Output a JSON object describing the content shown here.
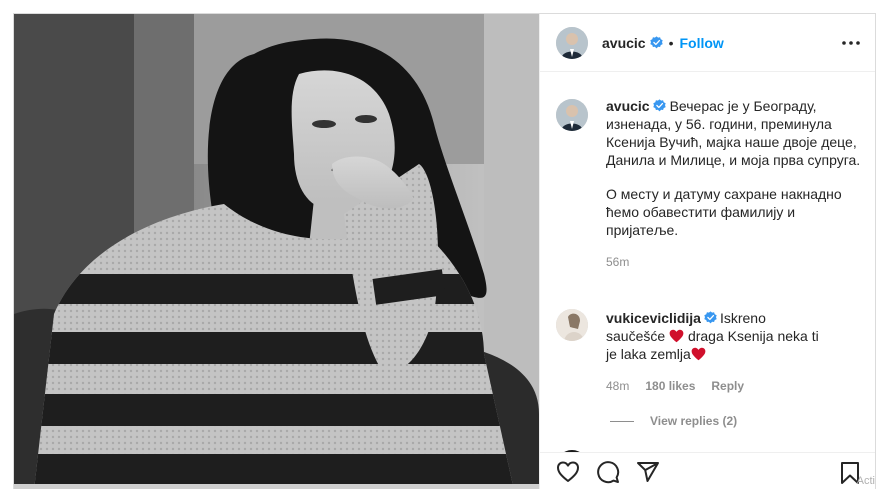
{
  "post": {
    "username": "avucic",
    "follow_label": "Follow",
    "separator": "•"
  },
  "caption": {
    "username": "avucic",
    "paragraph1": "Вечерас је у Београду, изненада, у 56. години, преминула Ксенија Вучић, мајка наше двоје деце, Данила и Милице, и моја прва супруга.",
    "paragraph2": "О месту и датуму сахране накнадно ћемо обавестити фамилију и пријатеље.",
    "time": "56m"
  },
  "comment": {
    "username": "vukiceviclidija",
    "text_part1": "Iskreno saučešće",
    "text_part2": "draga Ksenija neka ti je laka zemlja",
    "time": "48m",
    "likes": "180 likes",
    "reply_label": "Reply",
    "view_replies": "View replies (2)"
  },
  "next_comment": {
    "partial": "..."
  },
  "icons": {
    "like": "heart-icon",
    "comment": "comment-icon",
    "share": "share-icon",
    "save": "bookmark-icon",
    "more": "more-options-icon",
    "verified": "verified-badge-icon"
  },
  "colors": {
    "follow": "#0095f6",
    "verified": "#3897f0",
    "heart": "#ed4956"
  },
  "watermark": "Acti"
}
